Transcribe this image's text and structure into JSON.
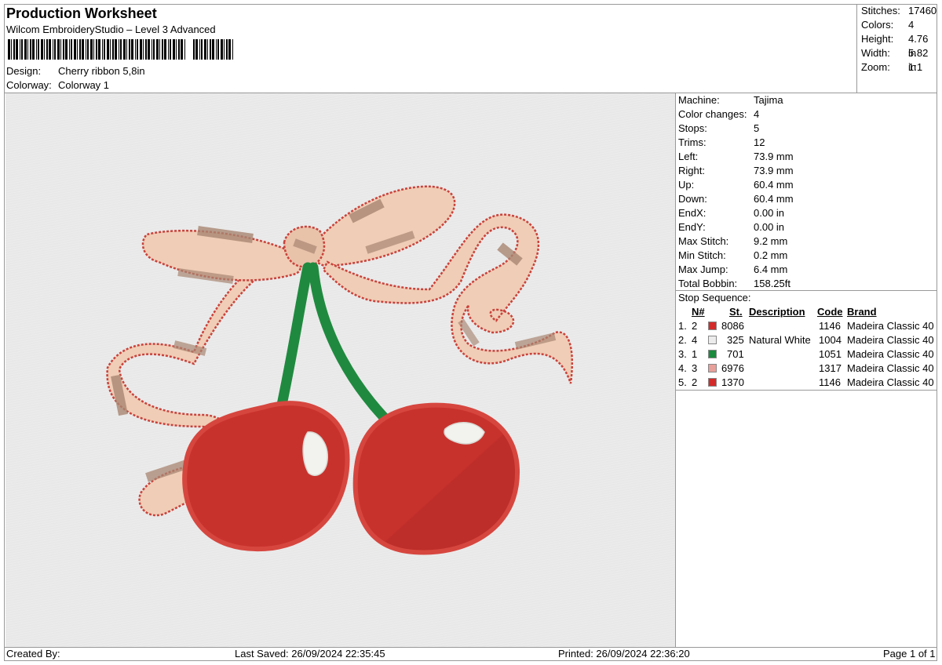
{
  "header": {
    "title": "Production Worksheet",
    "software": "Wilcom EmbroideryStudio – Level 3 Advanced",
    "design_label": "Design:",
    "design_value": "Cherry ribbon 5,8in",
    "colorway_label": "Colorway:",
    "colorway_value": "Colorway 1"
  },
  "summary": [
    {
      "label": "Stitches:",
      "value": "17460"
    },
    {
      "label": "Colors:",
      "value": "4"
    },
    {
      "label": "Height:",
      "value": "4.76 in"
    },
    {
      "label": "Width:",
      "value": "5.82 in"
    },
    {
      "label": "Zoom:",
      "value": "1:1"
    }
  ],
  "machine_info": [
    {
      "label": "Machine:",
      "value": "Tajima"
    },
    {
      "label": "Color changes:",
      "value": "4"
    },
    {
      "label": "Stops:",
      "value": "5"
    },
    {
      "label": "Trims:",
      "value": "12"
    },
    {
      "label": "Left:",
      "value": "73.9 mm"
    },
    {
      "label": "Right:",
      "value": "73.9 mm"
    },
    {
      "label": "Up:",
      "value": "60.4 mm"
    },
    {
      "label": "Down:",
      "value": "60.4 mm"
    },
    {
      "label": "EndX:",
      "value": "0.00 in"
    },
    {
      "label": "EndY:",
      "value": "0.00 in"
    },
    {
      "label": "Max Stitch:",
      "value": "9.2 mm"
    },
    {
      "label": "Min Stitch:",
      "value": "0.2 mm"
    },
    {
      "label": "Max Jump:",
      "value": "6.4 mm"
    },
    {
      "label": "Total Bobbin:",
      "value": "158.25ft"
    }
  ],
  "stop_sequence": {
    "label": "Stop Sequence:",
    "columns": {
      "n": "N#",
      "st": "St.",
      "description": "Description",
      "code": "Code",
      "brand": "Brand"
    },
    "rows": [
      {
        "idx": "1.",
        "n": "2",
        "color": "#d42a2a",
        "st": "8086",
        "description": "",
        "code": "1146",
        "brand": "Madeira Classic 40"
      },
      {
        "idx": "2.",
        "n": "4",
        "color": "#ececec",
        "st": "325",
        "description": "Natural White",
        "code": "1004",
        "brand": "Madeira Classic 40"
      },
      {
        "idx": "3.",
        "n": "1",
        "color": "#1a8a3c",
        "st": "701",
        "description": "",
        "code": "1051",
        "brand": "Madeira Classic 40"
      },
      {
        "idx": "4.",
        "n": "3",
        "color": "#e8a09a",
        "st": "6976",
        "description": "",
        "code": "1317",
        "brand": "Madeira Classic 40"
      },
      {
        "idx": "5.",
        "n": "2",
        "color": "#d42a2a",
        "st": "1370",
        "description": "",
        "code": "1146",
        "brand": "Madeira Classic 40"
      }
    ]
  },
  "footer": {
    "created_by": "Created By:",
    "last_saved": "Last Saved: 26/09/2024 22:35:45",
    "printed": "Printed: 26/09/2024 22:36:20",
    "page": "Page 1 of 1"
  },
  "colors": {
    "cherry_red": "#c8322d",
    "cherry_dark": "#b52a26",
    "stem_green": "#1f8a3f",
    "ribbon_fill": "#f0cdb6",
    "ribbon_shade": "#a98672",
    "ribbon_edge": "#c9423b",
    "highlight": "#f2f2ee"
  }
}
